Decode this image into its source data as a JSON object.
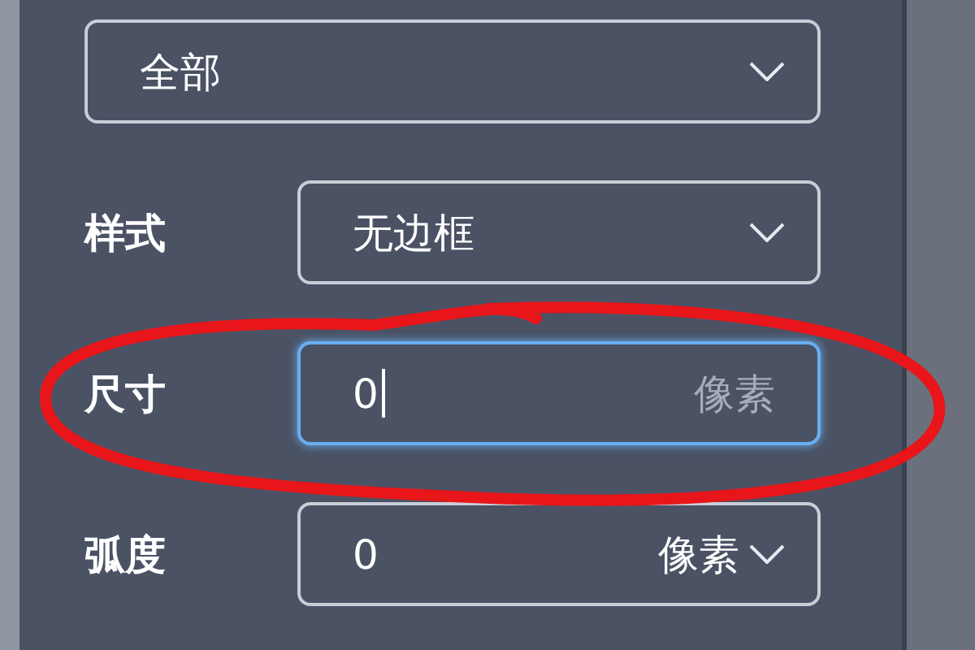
{
  "top_select": {
    "value": "全部"
  },
  "rows": [
    {
      "kind": "select",
      "label": "样式",
      "value": "无边框"
    },
    {
      "kind": "input",
      "label": "尺寸",
      "value": "0",
      "unit": "像素",
      "focused": true
    },
    {
      "kind": "unit_select",
      "label": "弧度",
      "value": "0",
      "unit": "像素",
      "focused": false
    }
  ]
}
